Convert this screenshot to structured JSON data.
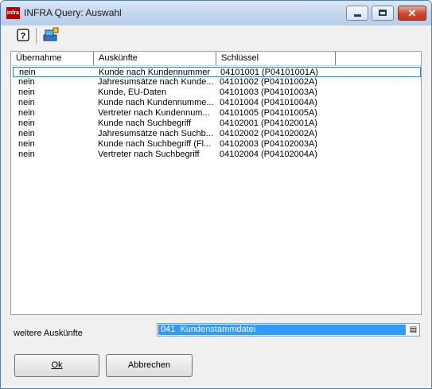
{
  "window": {
    "title": "INFRA Query:  Auswahl",
    "app_icon_text": "infra"
  },
  "toolbar": {
    "help_icon": "help-icon",
    "query_icon": "query-icon"
  },
  "table": {
    "columns": [
      "Übernahme",
      "Auskünfte",
      "Schlüssel"
    ],
    "rows": [
      [
        "nein",
        "Kunde nach Kundennummer",
        "04101001 (P04101001A)"
      ],
      [
        "nein",
        "Jahresumsätze nach Kunde...",
        "04101002 (P04101002A)"
      ],
      [
        "nein",
        "Kunde, EU-Daten",
        "04101003 (P04101003A)"
      ],
      [
        "nein",
        "Kunde nach Kundennumme...",
        "04101004 (P04101004A)"
      ],
      [
        "nein",
        "Vertreter nach Kundennum...",
        "04101005 (P04101005A)"
      ],
      [
        "nein",
        "Kunde nach Suchbegriff",
        "04102001 (P04102001A)"
      ],
      [
        "nein",
        "Jahresumsätze nach Suchb...",
        "04102002 (P04102002A)"
      ],
      [
        "nein",
        "Kunde nach Suchbegriff (Fl...",
        "04102003 (P04102003A)"
      ],
      [
        "nein",
        "Vertreter nach Suchbegriff",
        "04102004 (P04102004A)"
      ]
    ]
  },
  "weitere": {
    "label": "weitere Auskünfte",
    "value": "041  Kundenstammdatei"
  },
  "buttons": {
    "ok": "Ok",
    "cancel": "Abbrechen"
  },
  "colors": {
    "selection": "#3399ff",
    "title_gradient": "#c4d7ee"
  }
}
